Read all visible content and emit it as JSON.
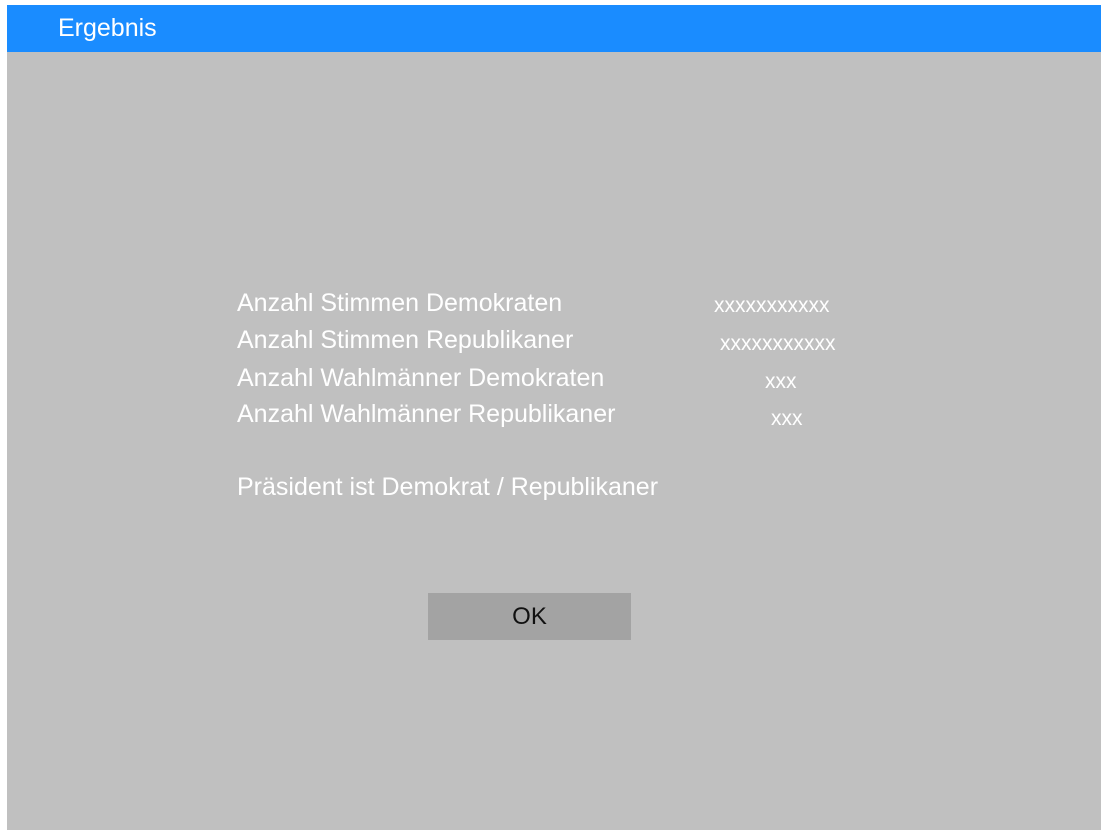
{
  "window": {
    "title": "Ergebnis"
  },
  "results": {
    "rows": [
      {
        "label": "Anzahl Stimmen Demokraten",
        "value": "xxxxxxxxxxx"
      },
      {
        "label": "Anzahl Stimmen Republikaner",
        "value": "xxxxxxxxxxx"
      },
      {
        "label": "Anzahl Wahlmänner Demokraten",
        "value": "xxx"
      },
      {
        "label": "Anzahl Wahlmänner Republikaner",
        "value": "xxx"
      }
    ],
    "president_text": "Präsident ist Demokrat / Republikaner"
  },
  "actions": {
    "ok_label": "OK"
  },
  "colors": {
    "titlebar": "#1a8cff",
    "background": "#c0c0c0",
    "button": "#a3a3a3",
    "text": "#ffffff"
  }
}
